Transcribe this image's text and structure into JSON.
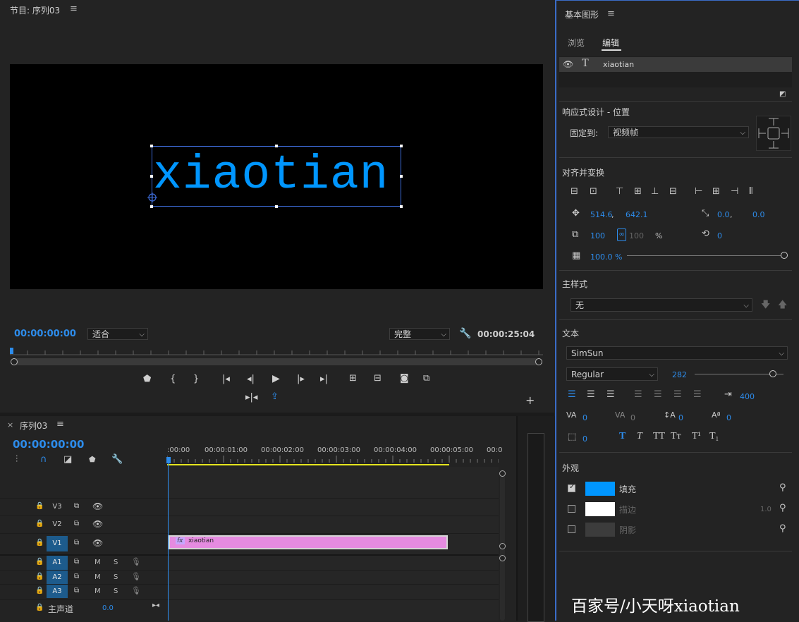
{
  "program_monitor": {
    "title": "节目: 序列03",
    "menu_icon": "hamburger-icon",
    "overlay_text": "xiaotian",
    "timecode_current": "00:00:00:00",
    "fit_select": "适合",
    "quality_select": "完整",
    "timecode_duration": "00:00:25:04"
  },
  "timeline": {
    "close": "×",
    "title": "序列03",
    "timecode": "00:00:00:00",
    "ruler": [
      ":00:00",
      "00:00:01:00",
      "00:00:02:00",
      "00:00:03:00",
      "00:00:04:00",
      "00:00:05:00",
      "00:0"
    ],
    "video_tracks": [
      {
        "label": "V3",
        "active": false
      },
      {
        "label": "V2",
        "active": false
      },
      {
        "label": "V1",
        "active": true
      }
    ],
    "audio_tracks": [
      {
        "label": "A1",
        "m": "M",
        "s": "S"
      },
      {
        "label": "A2",
        "m": "M",
        "s": "S"
      },
      {
        "label": "A3",
        "m": "M",
        "s": "S"
      }
    ],
    "master_label": "主声道",
    "master_value": "0.0",
    "clip": {
      "fx": "fx",
      "name": "xiaotian",
      "color": "#e58be0"
    }
  },
  "essential_graphics": {
    "title": "基本图形",
    "tabs": [
      "浏览",
      "编辑"
    ],
    "active_tab": "编辑",
    "layer_name": "xiaotian",
    "responsive_title": "响应式设计 - 位置",
    "pin_label": "固定到:",
    "pin_value": "视频帧",
    "align_title": "对齐并变换",
    "pos_x": "514.6",
    "pos_comma": ",",
    "pos_y": "642.1",
    "anchor_x": "0.0",
    "anchor_comma": ",",
    "anchor_y": "0.0",
    "scale": "100",
    "scale_linked": "100",
    "scale_unit": "%",
    "rotation": "0",
    "opacity": "100.0 %",
    "master_style_title": "主样式",
    "master_style_value": "无",
    "text_title": "文本",
    "font": "SimSun",
    "font_style": "Regular",
    "font_size": "282",
    "font_size_fraction": 0.282,
    "tracking_label": "400",
    "kerning": "0",
    "tracking": "0",
    "leading": "0",
    "baseline": "0",
    "tsume": "0",
    "style_buttons": [
      "T",
      "T",
      "TT",
      "Tт",
      "T¹",
      "T₁"
    ],
    "appearance_title": "外观",
    "fill_label": "填充",
    "fill_color": "#0096ff",
    "stroke_label": "描边",
    "stroke_color": "#ffffff",
    "stroke_width": "1.0",
    "shadow_label": "阴影",
    "shadow_color": "#3c3c3c"
  },
  "watermark": "百家号/小天呀xiaotian"
}
